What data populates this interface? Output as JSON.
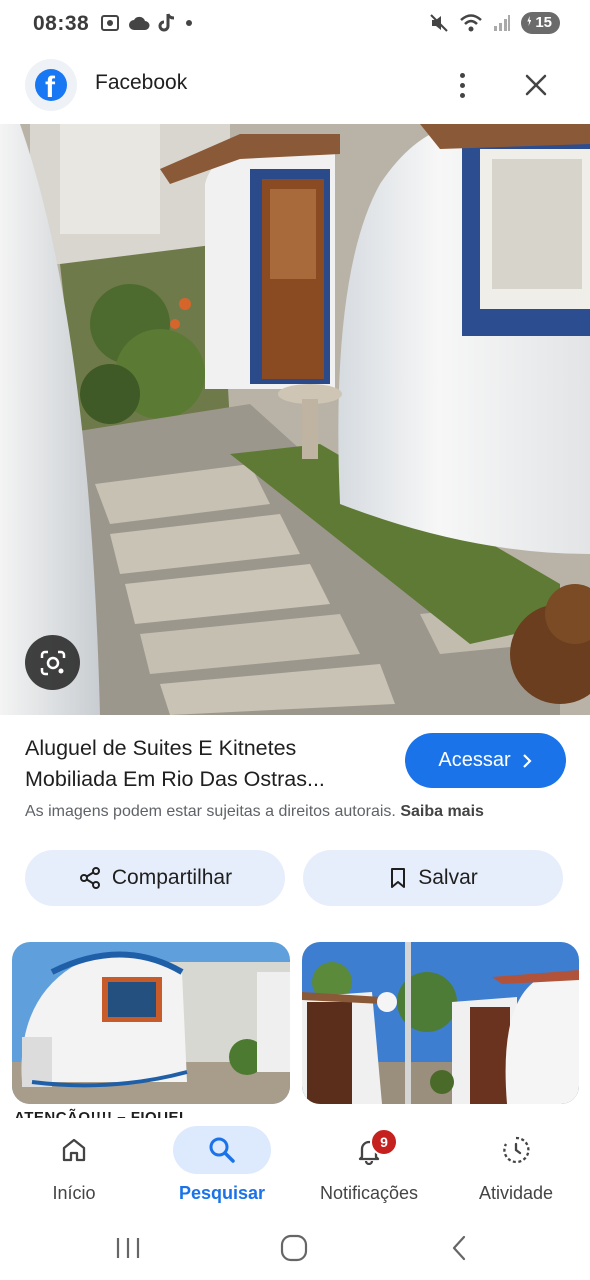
{
  "status_bar": {
    "time": "08:38",
    "battery": "15"
  },
  "header": {
    "title": "Facebook"
  },
  "result": {
    "title_line1": "Aluguel de Suites E Kitnetes",
    "title_line2": "Mobiliada Em Rio Das Ostras...",
    "visit_label": "Acessar",
    "copyright_text": "As imagens podem estar sujeitas a direitos autorais.",
    "learn_more": "Saiba mais"
  },
  "actions": {
    "share_label": "Compartilhar",
    "save_label": "Salvar"
  },
  "related": {
    "caption": "ATENÇÃO!!!! – FIQUEI"
  },
  "bottom_nav": {
    "items": [
      {
        "label": "Início",
        "icon": "home-icon"
      },
      {
        "label": "Pesquisar",
        "icon": "search-icon"
      },
      {
        "label": "Notificações",
        "icon": "bell-icon",
        "badge": "9"
      },
      {
        "label": "Atividade",
        "icon": "activity-icon"
      }
    ],
    "active_index": 1
  },
  "colors": {
    "accent": "#1a73e8",
    "facebook": "#1877f2",
    "pill_bg": "#e7eefb",
    "badge": "#c5221f"
  }
}
